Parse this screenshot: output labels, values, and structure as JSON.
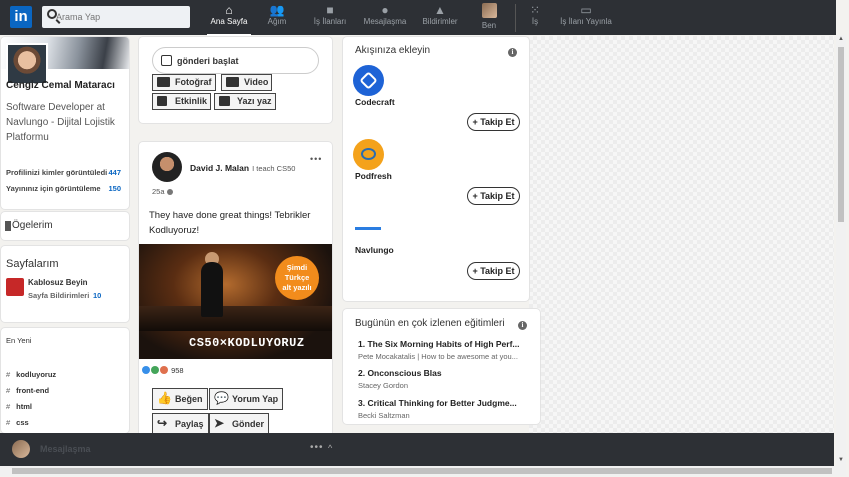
{
  "nav": {
    "logo": "in",
    "search_placeholder": "Arama Yap",
    "items": [
      {
        "label": "Ana Sayfa",
        "icon": "home-icon"
      },
      {
        "label": "Ağım",
        "icon": "network-icon"
      },
      {
        "label": "İş İlanları",
        "icon": "briefcase-icon"
      },
      {
        "label": "Mesajlaşma",
        "icon": "chat-icon"
      },
      {
        "label": "Bildirimler",
        "icon": "bell-icon"
      },
      {
        "label": "Ben",
        "icon": "avatar"
      },
      {
        "label": "İş",
        "icon": "grid-icon"
      },
      {
        "label": "İş İlanı Yayınla",
        "icon": "post-job-icon"
      }
    ]
  },
  "profile": {
    "name": "Cengiz Cemal Mataracı",
    "headline": "Software Developer at Navlungo - Dijital Lojistik Platformu",
    "stats": [
      {
        "label": "Profilinizi kimler görüntüledi",
        "value": "447"
      },
      {
        "label": "Yayınınız için görüntüleme",
        "value": "150"
      }
    ],
    "saved_items": "Ögelerim",
    "pages_title": "Sayfalarım",
    "page": {
      "name": "Kablosuz Beyin",
      "notif_label": "Sayfa Bildirimleri",
      "notif_count": "10"
    },
    "recent_title": "En Yeni",
    "hashtags": [
      "kodluyoruz",
      "front-end",
      "html",
      "css"
    ]
  },
  "share": {
    "start_label": "gönderi başlat",
    "buttons": [
      {
        "label": "Fotoğraf",
        "icon": "photo-icon"
      },
      {
        "label": "Video",
        "icon": "video-icon"
      },
      {
        "label": "Etkinlik",
        "icon": "calendar-icon"
      },
      {
        "label": "Yazı yaz",
        "icon": "article-icon"
      }
    ]
  },
  "post": {
    "author": "David J. Malan",
    "author_sub": "I teach CS50",
    "menu": "•••",
    "time": "25a",
    "text": "They have done great things! Tebrikler Kodluyoruz!",
    "image_badge": [
      "Şimdi",
      "Türkçe",
      "alt yazılı"
    ],
    "image_caption": "CS50×KODLUYORUZ",
    "reaction_count": "958",
    "actions": [
      {
        "label": "Beğen",
        "icon": "like-icon"
      },
      {
        "label": "Yorum Yap",
        "icon": "comment-icon"
      },
      {
        "label": "Paylaş",
        "icon": "share-icon"
      },
      {
        "label": "Gönder",
        "icon": "send-icon"
      }
    ]
  },
  "follow": {
    "title": "Akışınıza ekleyin",
    "info": "i",
    "follow_label": "+ Takip Et",
    "companies": [
      {
        "name": "Codecraft",
        "color": "#1e63d6"
      },
      {
        "name": "Podfresh",
        "color": "#f4a21b"
      },
      {
        "name": "Navlungo",
        "color": "#ffffff"
      }
    ]
  },
  "courses": {
    "title": "Bugünün en çok izlenen eğitimleri",
    "info": "i",
    "items": [
      {
        "title": "1. The Six Morning Habits of High Perf...",
        "author": "Pete Mocakatalis | How to be awesome at you..."
      },
      {
        "title": "2. Onconscious Blas",
        "author": "Stacey Gordon"
      },
      {
        "title": "3. Critical Thinking for Better Judgme...",
        "author": "Becki Saltzman"
      }
    ]
  },
  "messaging": {
    "label": "Mesajlaşma",
    "dots": "•••",
    "chevron": "^"
  },
  "colors": {
    "accent": "#0a66c2",
    "nav_bg": "#2d3035"
  }
}
